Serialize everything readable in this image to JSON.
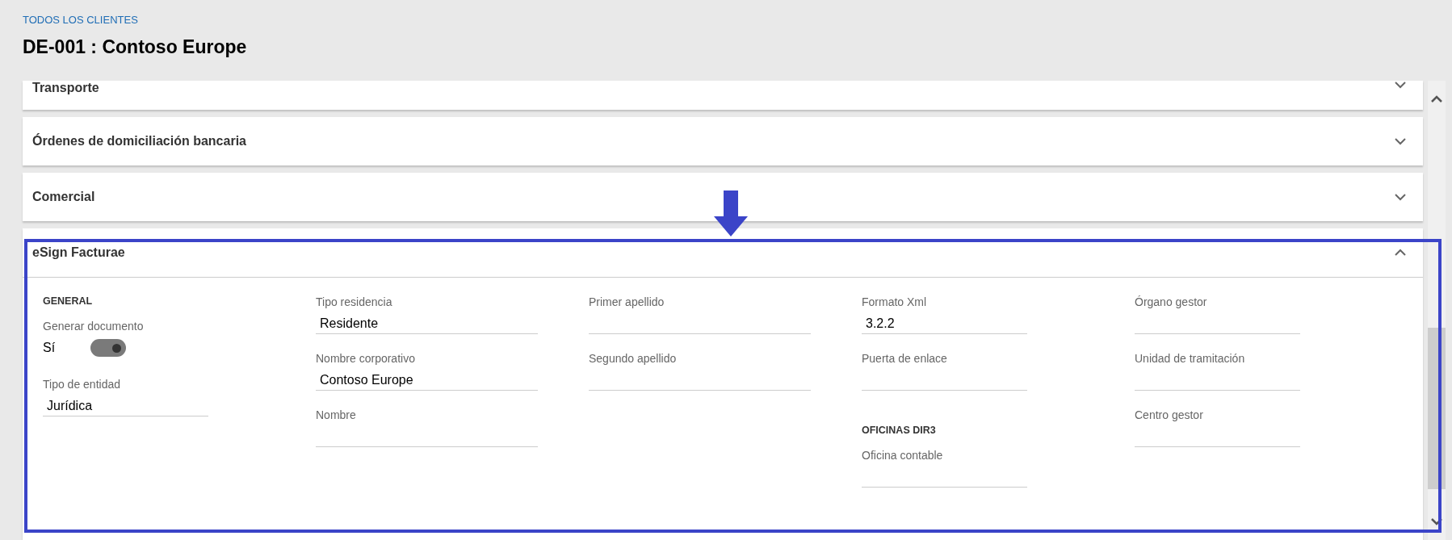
{
  "breadcrumb": "TODOS LOS CLIENTES",
  "title": "DE-001 : Contoso Europe",
  "sections": [
    {
      "title": "Transporte",
      "expanded": false
    },
    {
      "title": "Órdenes de domiciliación bancaria",
      "expanded": false
    },
    {
      "title": "Comercial",
      "expanded": false
    },
    {
      "title": "eSign Facturae",
      "expanded": true
    }
  ],
  "form_columns": [
    [
      {
        "kind": "heading",
        "text": "GENERAL"
      },
      {
        "kind": "toggle",
        "label": "Generar documento",
        "value": "Sí",
        "on": true
      },
      {
        "kind": "field",
        "label": "Tipo de entidad",
        "value": "Jurídica"
      }
    ],
    [
      {
        "kind": "field",
        "label": "Tipo residencia",
        "value": "Residente"
      },
      {
        "kind": "field",
        "label": "Nombre corporativo",
        "value": "Contoso Europe"
      },
      {
        "kind": "field",
        "label": "Nombre"
      }
    ],
    [
      {
        "kind": "field",
        "label": "Primer apellido"
      },
      {
        "kind": "field",
        "label": "Segundo apellido"
      }
    ],
    [
      {
        "kind": "field",
        "label": "Formato Xml",
        "value": "3.2.2"
      },
      {
        "kind": "field",
        "label": "Puerta de enlace"
      },
      {
        "kind": "heading",
        "text": "OFICINAS DIR3"
      },
      {
        "kind": "field",
        "label": "Oficina contable"
      }
    ],
    [
      {
        "kind": "field",
        "label": "Órgano gestor"
      },
      {
        "kind": "field",
        "label": "Unidad de tramitación"
      },
      {
        "kind": "field",
        "label": "Centro gestor"
      }
    ]
  ]
}
